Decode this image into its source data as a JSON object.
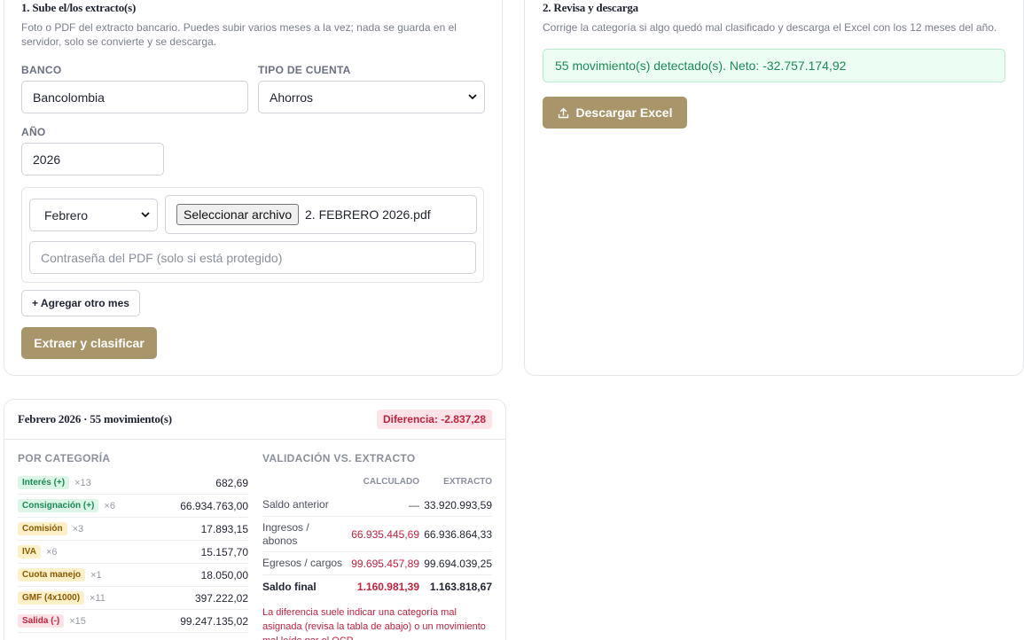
{
  "upload": {
    "title": "1. Sube el/los extracto(s)",
    "description": "Foto o PDF del extracto bancario. Puedes subir varios meses a la vez; nada se guarda en el servidor, solo se convierte y se descarga.",
    "bank_label": "BANCO",
    "bank_value": "Bancolombia",
    "account_type_label": "TIPO DE CUENTA",
    "account_type_value": "Ahorros",
    "year_label": "AÑO",
    "year_value": "2026",
    "month_value": "Febrero",
    "file_button": "Seleccionar archivo",
    "file_name": "2. FEBRERO 2026.pdf",
    "password_placeholder": "Contraseña del PDF (solo si está protegido)",
    "add_month_button": "+ Agregar otro mes",
    "extract_button": "Extraer y clasificar"
  },
  "review": {
    "title": "2. Revisa y descarga",
    "description": "Corrige la categoría si algo quedó mal clasificado y descarga el Excel con los 12 meses del año.",
    "status": "55 movimiento(s) detectado(s). Neto: -32.757.174,92",
    "download_button": "Descargar Excel"
  },
  "month": {
    "title": "Febrero 2026 · 55 movimiento(s)",
    "difference": "Diferencia: -2.837,28",
    "by_category_label": "POR CATEGORÍA",
    "categories": [
      {
        "name": "Interés (+)",
        "count": "×13",
        "amount": "682,69",
        "bg": "#dcf5e6",
        "fg": "#1a8a55"
      },
      {
        "name": "Consignación (+)",
        "count": "×6",
        "amount": "66.934.763,00",
        "bg": "#dcf5e6",
        "fg": "#1a8a55"
      },
      {
        "name": "Comisión",
        "count": "×3",
        "amount": "17.893,15",
        "bg": "#fdf0c8",
        "fg": "#8a5a00"
      },
      {
        "name": "IVA",
        "count": "×6",
        "amount": "15.157,70",
        "bg": "#fdf0c8",
        "fg": "#8a5a00"
      },
      {
        "name": "Cuota manejo",
        "count": "×1",
        "amount": "18.050,00",
        "bg": "#fdf0c8",
        "fg": "#8a5a00"
      },
      {
        "name": "GMF (4x1000)",
        "count": "×11",
        "amount": "397.222,02",
        "bg": "#fdf0c8",
        "fg": "#8a5a00"
      },
      {
        "name": "Salida (-)",
        "count": "×15",
        "amount": "99.247.135,02",
        "bg": "#fde2e7",
        "fg": "#c0223f"
      }
    ],
    "validation_label": "VALIDACIÓN VS. EXTRACTO",
    "col_calculated": "CALCULADO",
    "col_statement": "EXTRACTO",
    "rows": [
      {
        "label": "Saldo anterior",
        "calculated": "—",
        "statement": "33.920.993,59"
      },
      {
        "label": "Ingresos / abonos",
        "calculated": "66.935.445,69",
        "statement": "66.936.864,33"
      },
      {
        "label": "Egresos / cargos",
        "calculated": "99.695.457,89",
        "statement": "99.694.039,25"
      },
      {
        "label": "Saldo final",
        "calculated": "1.160.981,39",
        "statement": "1.163.818,67"
      }
    ],
    "warning": "La diferencia suele indicar una categoría mal asignada (revisa la tabla de abajo) o un movimiento mal leído por el OCR."
  }
}
